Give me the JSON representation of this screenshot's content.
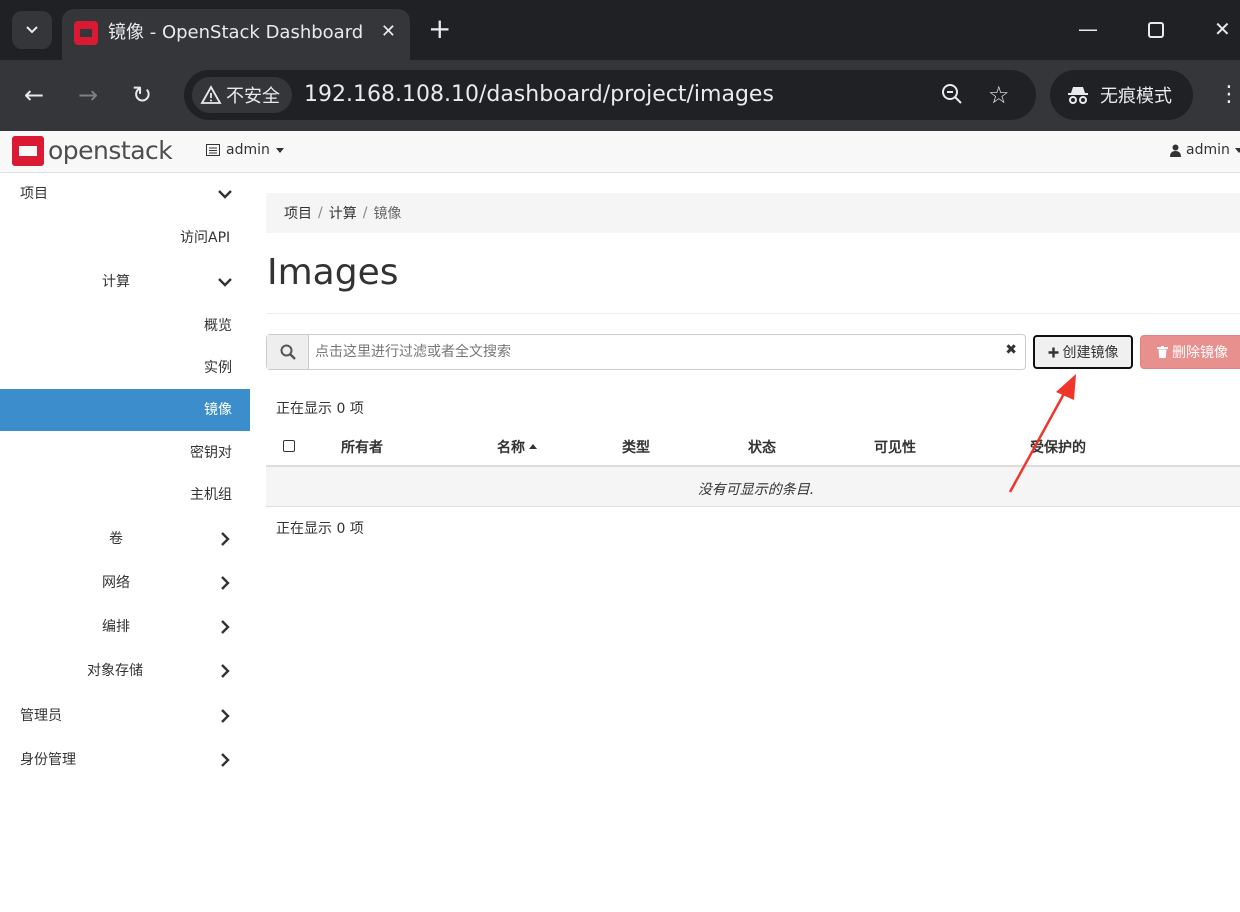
{
  "browser": {
    "tab_title": "镜像 - OpenStack Dashboard",
    "security_label": "不安全",
    "url": "192.168.108.10/dashboard/project/images",
    "incognito_label": "无痕模式"
  },
  "navbar": {
    "brand": "openstack",
    "project_menu": "admin",
    "user_menu": "admin"
  },
  "sidebar": {
    "project": "项目",
    "api_access": "访问API",
    "compute": "计算",
    "overview": "概览",
    "instances": "实例",
    "images": "镜像",
    "keypairs": "密钥对",
    "server_groups": "主机组",
    "volumes": "卷",
    "network": "网络",
    "orchestration": "编排",
    "object_store": "对象存储",
    "admin": "管理员",
    "identity": "身份管理"
  },
  "breadcrumb": {
    "project": "项目",
    "compute": "计算",
    "current": "镜像",
    "separator": "/"
  },
  "page": {
    "title": "Images",
    "search_placeholder": "点击这里进行过滤或者全文搜索",
    "create_button": "创建镜像",
    "delete_button": "删除镜像",
    "count_top": "正在显示 0 项",
    "count_bottom": "正在显示 0 项"
  },
  "table": {
    "columns": [
      "所有者",
      "名称",
      "类型",
      "状态",
      "可见性",
      "受保护的"
    ],
    "empty_message": "没有可显示的条目."
  },
  "colors": {
    "sidebar_active": "#3c8dcc",
    "brand_red": "#da1a32",
    "danger_disabled": "#e8908e",
    "annotation_arrow": "#f0352b"
  }
}
